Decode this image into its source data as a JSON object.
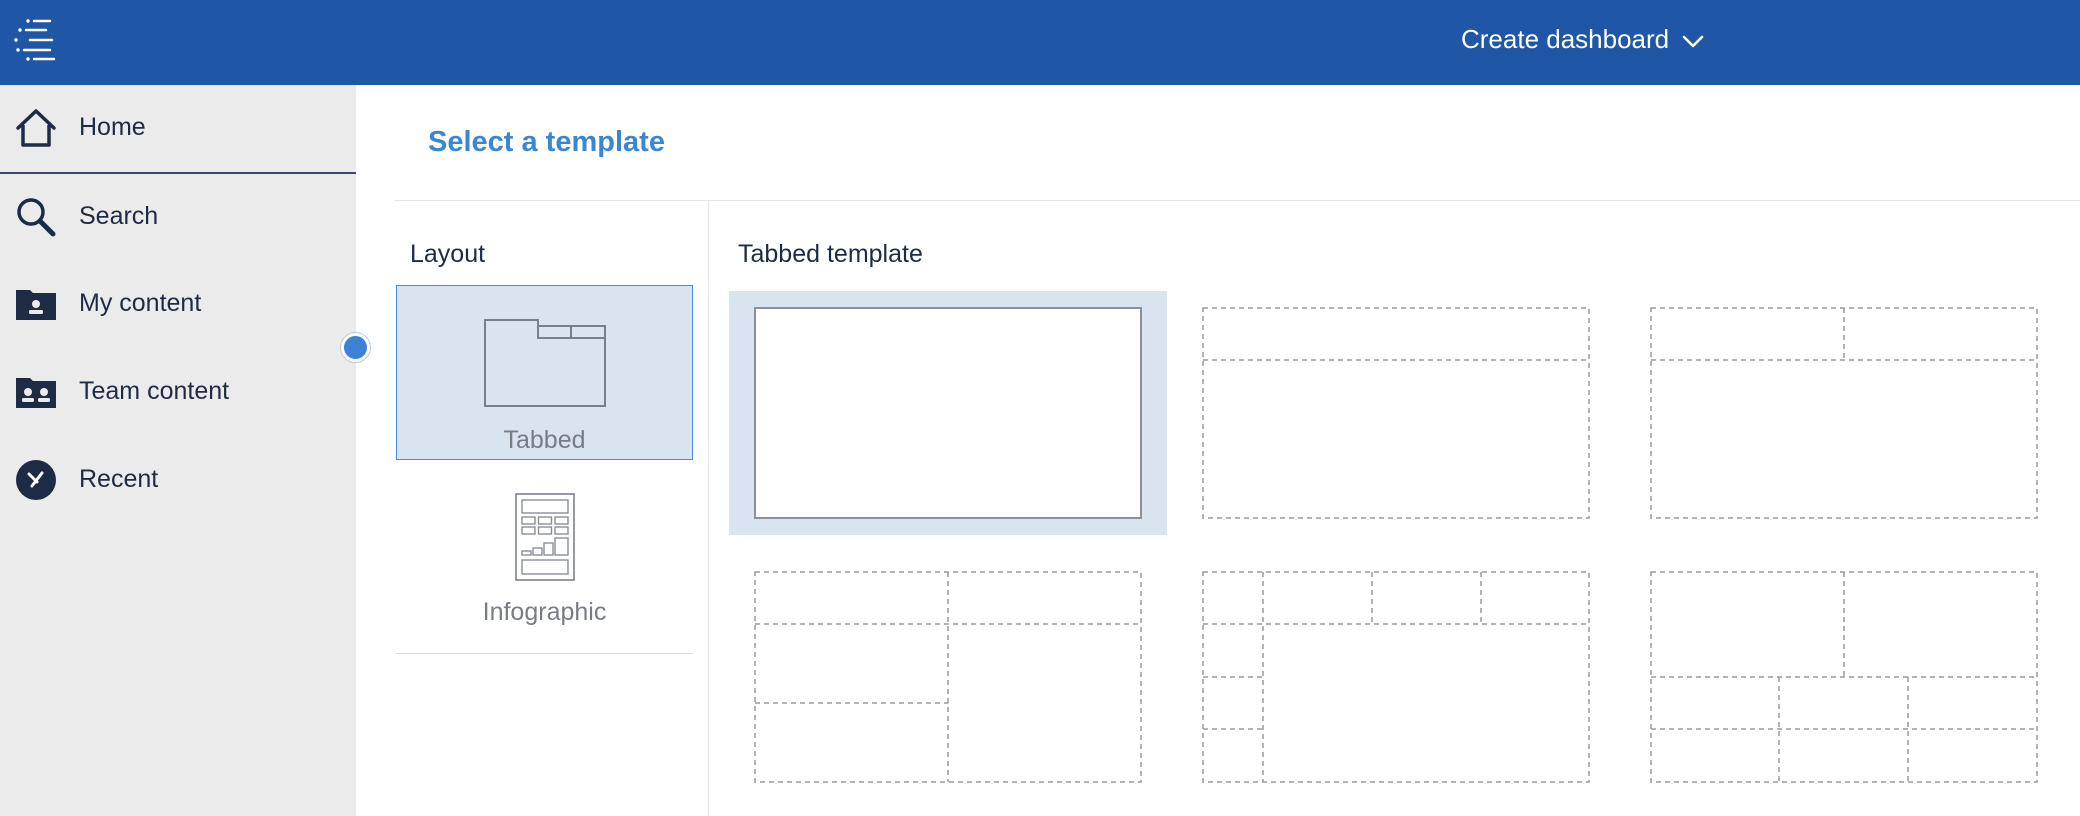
{
  "topbar": {
    "menu_icon": "hamburger-menu-icon",
    "create_label": "Create dashboard",
    "chevron_icon": "chevron-down-icon",
    "color": "#1f56a5"
  },
  "sidebar": {
    "items": [
      {
        "label": "Home",
        "icon": "home-icon"
      },
      {
        "label": "Search",
        "icon": "search-icon"
      },
      {
        "label": "My content",
        "icon": "my-content-icon"
      },
      {
        "label": "Team content",
        "icon": "team-content-icon"
      },
      {
        "label": "Recent",
        "icon": "recent-icon"
      }
    ]
  },
  "main": {
    "title": "Select a template",
    "title_color": "#3a86d2",
    "layout_heading": "Layout",
    "layouts": [
      {
        "label": "Tabbed",
        "selected": true
      },
      {
        "label": "Infographic",
        "selected": false
      }
    ],
    "templates_heading": "Tabbed template",
    "selected_template_index": 0
  }
}
